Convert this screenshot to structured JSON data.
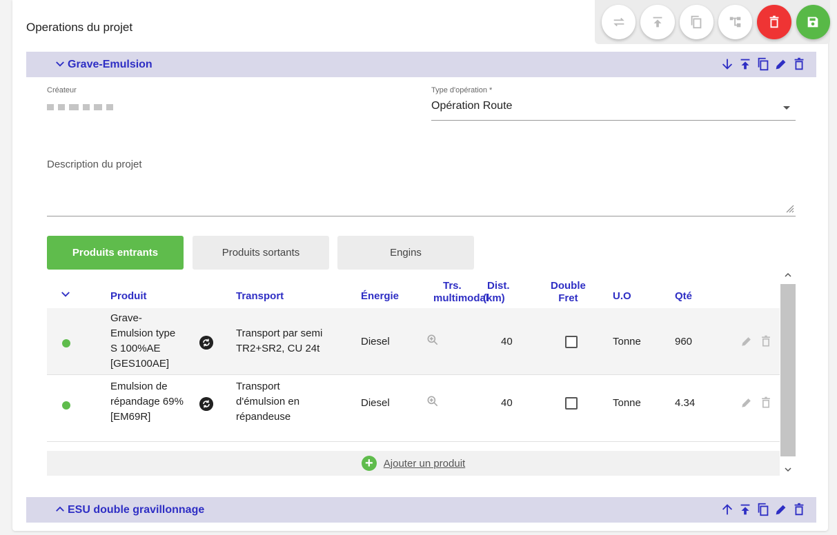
{
  "page_title": "Operations du projet",
  "toolbar": {
    "buttons": [
      "swap-icon",
      "move-top-icon",
      "copy-icon",
      "tree-icon",
      "delete-icon",
      "save-icon"
    ],
    "colors": {
      "delete": "#ef3434",
      "save": "#58b947"
    }
  },
  "sections": [
    {
      "title": "Grave-Emulsion",
      "expanded": true
    },
    {
      "title": "ESU double gravillonnage",
      "expanded": false
    }
  ],
  "form": {
    "createur_label": "Créateur",
    "type_label": "Type d'opération *",
    "type_value": "Opération Route",
    "description_placeholder": "Description du projet"
  },
  "tabs": [
    {
      "label": "Produits entrants",
      "active": true
    },
    {
      "label": "Produits sortants",
      "active": false
    },
    {
      "label": "Engins",
      "active": false
    }
  ],
  "table": {
    "headers": {
      "produit": "Produit",
      "transport": "Transport",
      "energie": "Énergie",
      "trs1": "Trs.",
      "trs2": "multimodal",
      "dist1": "Dist.",
      "dist2": "(km)",
      "double1": "Double",
      "double2": "Fret",
      "uo": "U.O",
      "qte": "Qté"
    },
    "rows": [
      {
        "produit": [
          "Grave-",
          "Emulsion type",
          "S 100%AE",
          "[GES100AE]"
        ],
        "transport": [
          "Transport par semi",
          "TR2+SR2, CU 24t"
        ],
        "energie": "Diesel",
        "dist": "40",
        "uo": "Tonne",
        "qte": "960"
      },
      {
        "produit": [
          "Emulsion de",
          "répandage 69%",
          "[EM69R]"
        ],
        "transport": [
          "Transport",
          "d'émulsion en",
          "répandeuse"
        ],
        "energie": "Diesel",
        "dist": "40",
        "uo": "Tonne",
        "qte": "4.34"
      }
    ]
  },
  "add_product_label": "Ajouter un produit",
  "accent_colors": {
    "primary": "#2e2ec4",
    "green": "#5fbc4c",
    "section_bg": "#d9d8ea"
  }
}
